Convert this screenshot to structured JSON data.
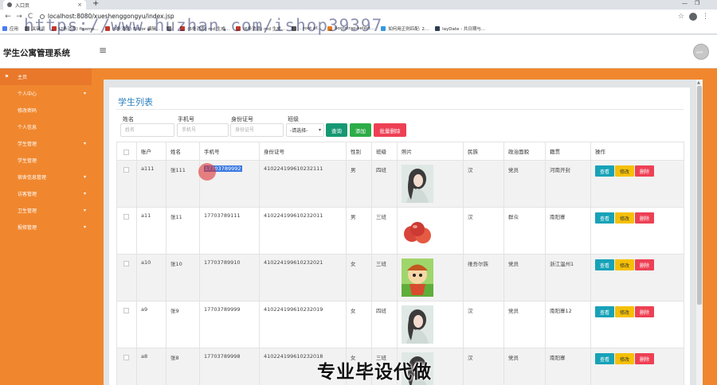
{
  "browser": {
    "tab_title": "入口页",
    "tab_close": "×",
    "new_tab": "+",
    "url": "localhost:8080/xueshenggongyu/index.jsp",
    "back": "←",
    "forward": "→",
    "reload": "C",
    "star": "☆",
    "kebab": "⋮",
    "minimize": "—",
    "restore": "❐",
    "bookmarks": [
      {
        "label": "应用",
        "color": "#4b7bec"
      },
      {
        "label": "关键词",
        "color": "#6f6f6f"
      },
      {
        "label": "(2条消息) fineme...",
        "color": "#c0392b"
      },
      {
        "label": "(6条消息) Editor 编辑...",
        "color": "#c0392b"
      },
      {
        "label": "",
        "color": "#777"
      },
      {
        "label": "(6条消息) md 生成...",
        "color": "#c0392b"
      },
      {
        "label": "(6条消息) md 生成...",
        "color": "#c0392b"
      },
      {
        "label": "...root of...",
        "color": "#555"
      },
      {
        "label": "bootstrap-select...",
        "color": "#e67e22"
      },
      {
        "label": "如何用正则匹配: 2...",
        "color": "#3498db"
      },
      {
        "label": "layDate - 共日期与...",
        "color": "#2c3e50"
      }
    ]
  },
  "watermark": "https://www.huzhan.com/ishop39397",
  "app": {
    "title": "学生公寓管理系统",
    "menu_toggle": "≡",
    "avatar_text": "user"
  },
  "sidebar": {
    "items": [
      {
        "label": "主页",
        "icon": "flag-icon",
        "glyph": "⚑",
        "sub": false,
        "chev": ""
      },
      {
        "label": "个人中心",
        "icon": "user-icon",
        "glyph": "",
        "sub": false,
        "chev": "▾"
      },
      {
        "label": "修改密码",
        "icon": "",
        "glyph": "",
        "sub": true,
        "chev": ""
      },
      {
        "label": "个人信息",
        "icon": "",
        "glyph": "",
        "sub": true,
        "chev": ""
      },
      {
        "label": "学生管理",
        "icon": "students-icon",
        "glyph": "",
        "sub": false,
        "chev": "▾"
      },
      {
        "label": "学生管理",
        "icon": "",
        "glyph": "",
        "sub": true,
        "chev": ""
      },
      {
        "label": "宿舍信息管理",
        "icon": "dorm-icon",
        "glyph": "",
        "sub": false,
        "chev": "▾"
      },
      {
        "label": "访客管理",
        "icon": "visitor-icon",
        "glyph": "",
        "sub": false,
        "chev": "▾"
      },
      {
        "label": "卫生管理",
        "icon": "hygiene-icon",
        "glyph": "",
        "sub": false,
        "chev": "▾"
      },
      {
        "label": "报修管理",
        "icon": "repair-icon",
        "glyph": "",
        "sub": false,
        "chev": "▾"
      }
    ]
  },
  "main": {
    "heading": "学生列表",
    "filters": {
      "name_label": "姓名",
      "name_placeholder": "姓名",
      "phone_label": "手机号",
      "phone_placeholder": "手机号",
      "idcard_label": "身份证号",
      "idcard_placeholder": "身份证号",
      "class_label": "班级",
      "class_selected": "-请选择-"
    },
    "buttons": {
      "query": "查询",
      "add": "添加",
      "batch_delete": "批量删除"
    },
    "table": {
      "headers": [
        "",
        "账户",
        "姓名",
        "手机号",
        "身份证号",
        "性别",
        "班级",
        "照片",
        "民族",
        "政治面貌",
        "籍贯",
        "操作"
      ],
      "rows": [
        {
          "account": "a111",
          "name": "张111",
          "phone": "17703789992",
          "idcard": "410224199610232111",
          "gender": "男",
          "class": "四班",
          "photo": "girl",
          "ethnic": "汉",
          "political": "党员",
          "origin": "河南开封"
        },
        {
          "account": "a11",
          "name": "张11",
          "phone": "17703789111",
          "idcard": "410224199610232011",
          "gender": "男",
          "class": "三班",
          "photo": "apples",
          "ethnic": "汉",
          "political": "群众",
          "origin": "南阳寨"
        },
        {
          "account": "a10",
          "name": "张10",
          "phone": "17703789910",
          "idcard": "410224199610232021",
          "gender": "女",
          "class": "三班",
          "photo": "cartoon",
          "ethnic": "维吾尔族",
          "political": "党员",
          "origin": "浙江温州1"
        },
        {
          "account": "a9",
          "name": "张9",
          "phone": "17703789999",
          "idcard": "410224199610232019",
          "gender": "女",
          "class": "四班",
          "photo": "girl",
          "ethnic": "汉",
          "political": "党员",
          "origin": "南阳寨12"
        },
        {
          "account": "a8",
          "name": "张8",
          "phone": "17703789998",
          "idcard": "410224199610232018",
          "gender": "女",
          "class": "三班",
          "photo": "girl",
          "ethnic": "汉",
          "political": "党员",
          "origin": "南阳寨"
        }
      ],
      "actions": {
        "view": "查看",
        "edit": "修改",
        "delete": "删除"
      }
    }
  },
  "overlay_caption": "专业毕设代做",
  "colors": {
    "sidebar": "#f0872e",
    "heading": "#2a7fbf",
    "query": "#169873",
    "add": "#2eac48",
    "danger": "#ee4054",
    "info": "#17a2b8",
    "warning": "#f5c006"
  }
}
